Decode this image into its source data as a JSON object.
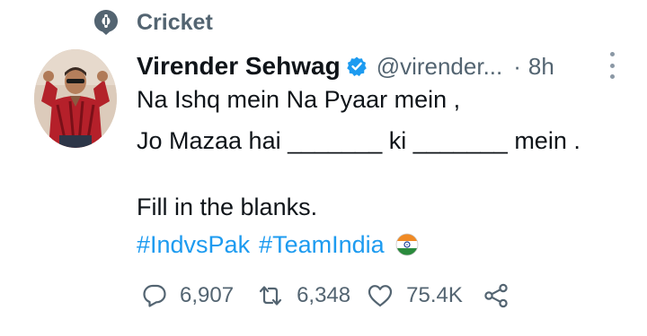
{
  "topic": {
    "label": "Cricket",
    "icon": "topic-icon"
  },
  "tweet": {
    "author": {
      "name": "Virender Sehwag",
      "handle": "@virender...",
      "verified": true,
      "avatar_icon": "avatar-photo"
    },
    "separator": "·",
    "time": "8h",
    "lines": [
      "Na Ishq mein Na Pyaar mein ,",
      "Jo Mazaa hai _______ ki _______ mein .",
      "Fill in the blanks."
    ],
    "hashtags": [
      "#IndvsPak",
      "#TeamIndia"
    ],
    "emoji": "indian-flag-emoji"
  },
  "actions": {
    "reply": "6,907",
    "retweet": "6,348",
    "like": "75.4K",
    "share_icon": "share-icon"
  },
  "colors": {
    "link": "#1d9bf0",
    "secondary_text": "#536471",
    "primary_text": "#0f1419",
    "verified": "#1d9bf0"
  }
}
